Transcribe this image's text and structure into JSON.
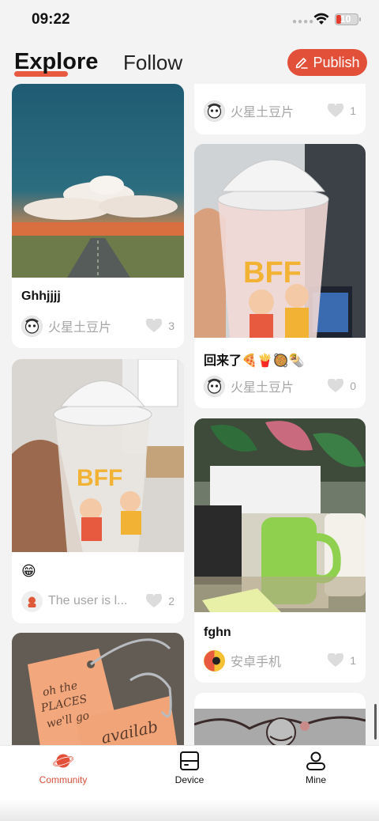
{
  "status": {
    "time": "09:22",
    "battery": "10"
  },
  "header": {
    "tab_explore": "Explore",
    "tab_follow": "Follow",
    "publish_label": "Publish"
  },
  "feed": {
    "left": [
      {
        "title": "Ghhjjjj",
        "author": "火星土豆片",
        "likes": "3",
        "image": "sunset-road-photo"
      },
      {
        "title": "😁",
        "author": "The user is l...",
        "likes": "2",
        "image": "bff-cup-photo"
      },
      {
        "title": "",
        "author": "",
        "likes": "",
        "image": "leather-tags-photo"
      }
    ],
    "right": [
      {
        "title": "",
        "author": "火星土豆片",
        "likes": "1",
        "image": ""
      },
      {
        "title": "回来了🍕🍟🥘🌯",
        "author": "火星土豆片",
        "likes": "0",
        "image": "bff-cup-photo"
      },
      {
        "title": "fghn",
        "author": "安卓手机",
        "likes": "1",
        "image": "desk-mug-plant-photo"
      },
      {
        "title": "",
        "author": "",
        "likes": "",
        "image": "drawing-photo"
      }
    ]
  },
  "tabbar": {
    "community": "Community",
    "device": "Device",
    "mine": "Mine"
  },
  "colors": {
    "accent": "#e2503a",
    "muted": "#a5a5a5"
  }
}
